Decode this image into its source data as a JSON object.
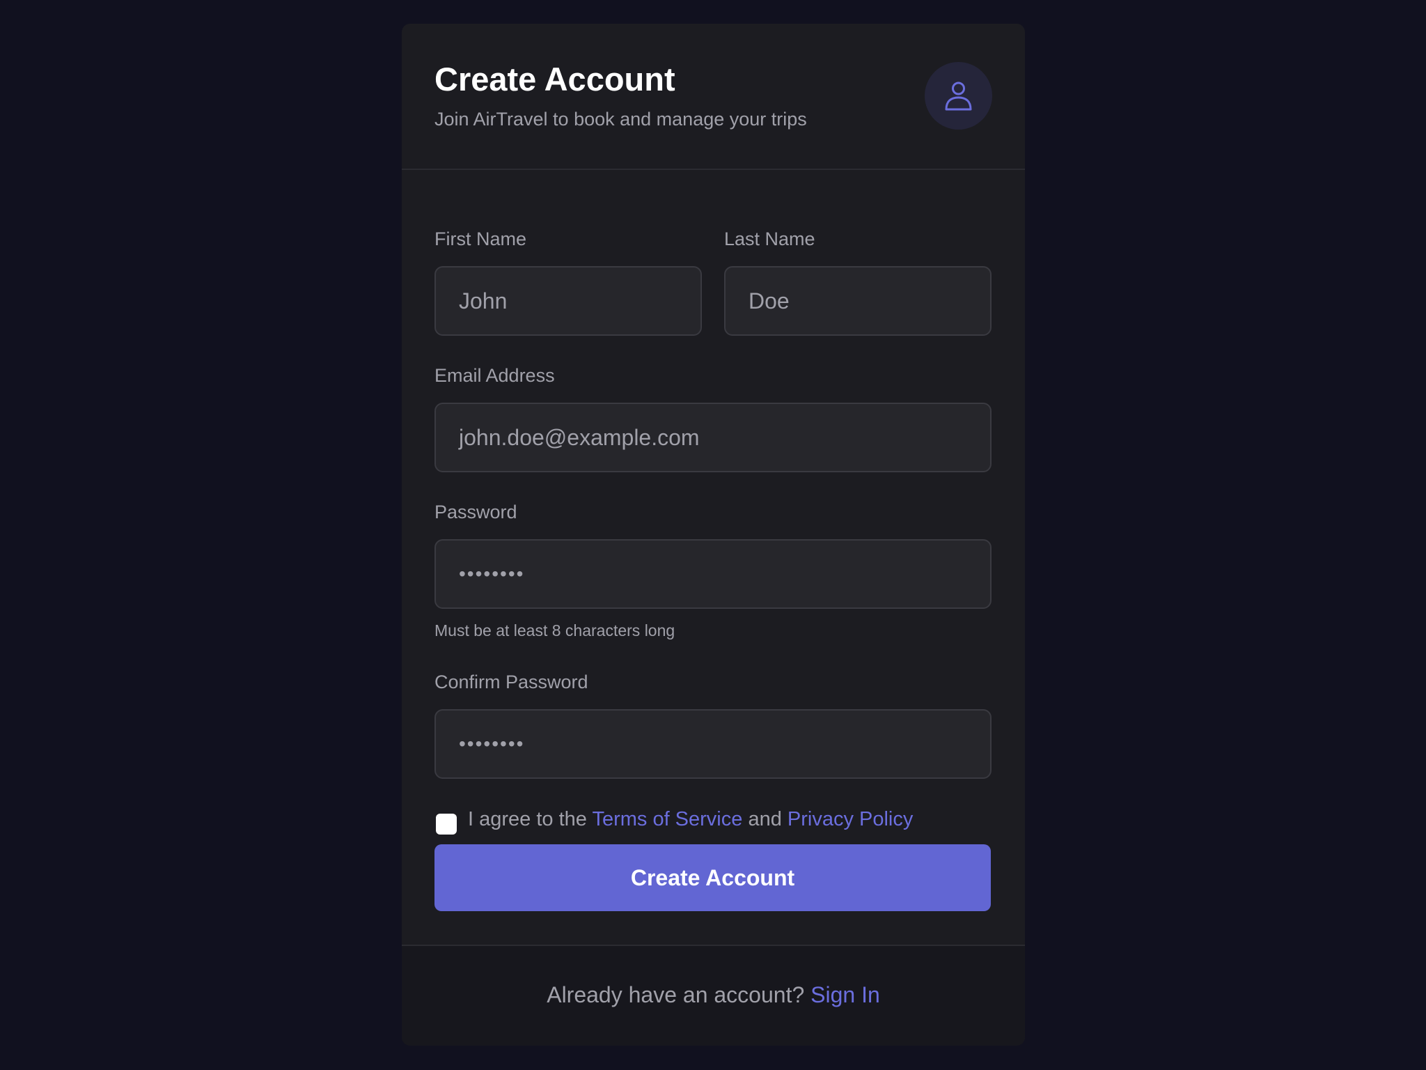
{
  "header": {
    "title": "Create Account",
    "subtitle": "Join AirTravel to book and manage your trips",
    "avatar_icon": "user-icon"
  },
  "form": {
    "first_name": {
      "label": "First Name",
      "value": "John"
    },
    "last_name": {
      "label": "Last Name",
      "value": "Doe"
    },
    "email": {
      "label": "Email Address",
      "value": "john.doe@example.com"
    },
    "password": {
      "label": "Password",
      "value": "••••••••",
      "hint": "Must be at least 8 characters long"
    },
    "confirm_password": {
      "label": "Confirm Password",
      "value": "••••••••"
    },
    "terms": {
      "checked": false,
      "prefix": "I agree to the ",
      "terms_link": "Terms of Service",
      "middle": " and ",
      "privacy_link": "Privacy Policy"
    },
    "submit_label": "Create Account"
  },
  "footer": {
    "prompt": "Already have an account? ",
    "link": "Sign In"
  },
  "colors": {
    "page_background": "#11111f",
    "card_background": "#1c1c21",
    "accent": "#6266d3",
    "link": "#6b6ede"
  }
}
